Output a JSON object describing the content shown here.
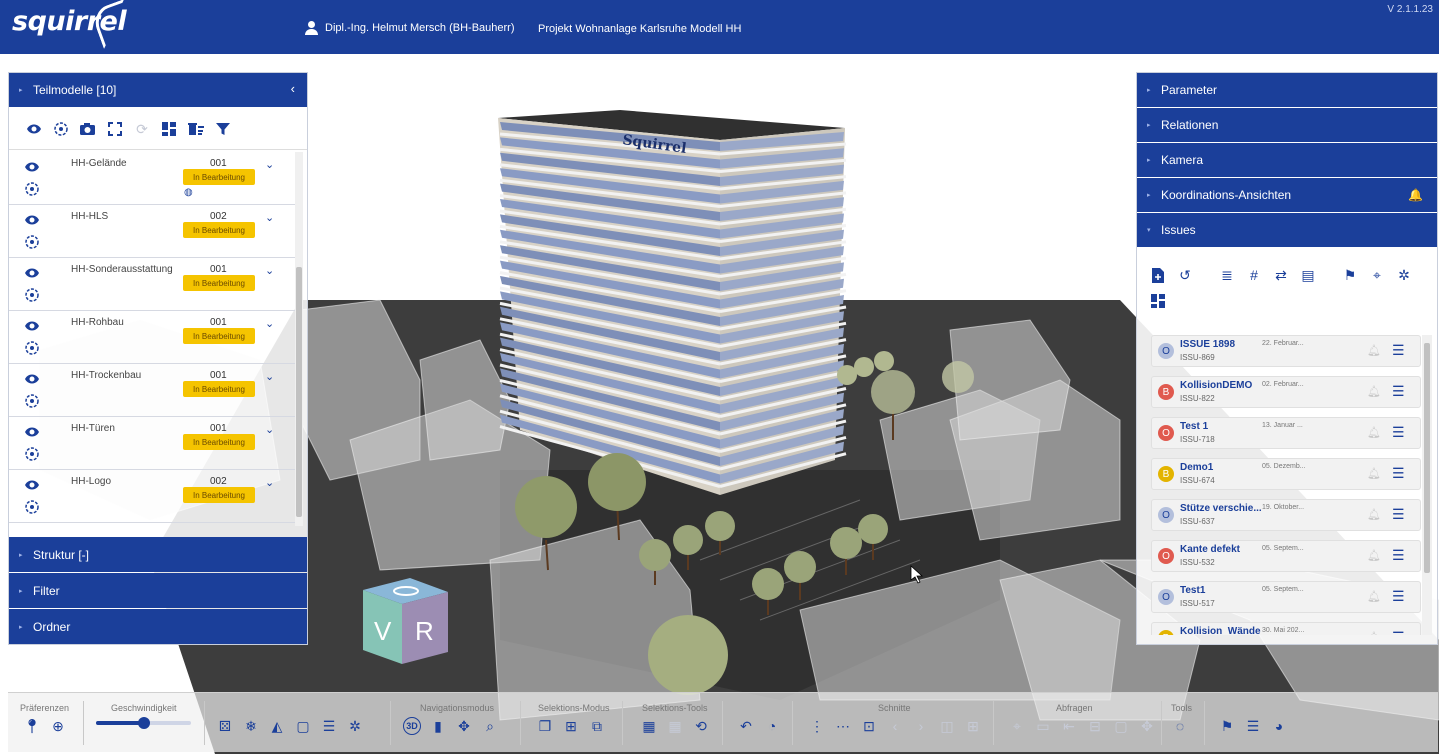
{
  "header": {
    "logo": "squirrel",
    "user": "Dipl.-Ing. Helmut Mersch (BH-Bauherr)",
    "project": "Projekt Wohnanlage Karlsruhe Modell HH",
    "version": "V 2.1.1.23"
  },
  "left_panel": {
    "title": "Teilmodelle [10]",
    "models": [
      {
        "name": "HH-Gelände",
        "num": "001",
        "status": "In Bearbeitung"
      },
      {
        "name": "HH-HLS",
        "num": "002",
        "status": "In Bearbeitung"
      },
      {
        "name": "HH-Sonderausstattung",
        "num": "001",
        "status": "In Bearbeitung"
      },
      {
        "name": "HH-Rohbau",
        "num": "001",
        "status": "In Bearbeitung"
      },
      {
        "name": "HH-Trockenbau",
        "num": "001",
        "status": "In Bearbeitung"
      },
      {
        "name": "HH-Türen",
        "num": "001",
        "status": "In Bearbeitung"
      },
      {
        "name": "HH-Logo",
        "num": "002",
        "status": "In Bearbeitung"
      }
    ],
    "sections": [
      "Struktur [-]",
      "Filter",
      "Ordner"
    ]
  },
  "right_panel": {
    "sections": [
      "Parameter",
      "Relationen",
      "Kamera",
      "Koordinations-Ansichten",
      "Issues"
    ],
    "issues": [
      {
        "letter": "O",
        "color": "#b3bfdc",
        "title": "ISSUE 1898",
        "id": "ISSU-869",
        "date": "22. Februar..."
      },
      {
        "letter": "B",
        "color": "#e05a4f",
        "title": "KollisionDEMO",
        "id": "ISSU-822",
        "date": "02. Februar..."
      },
      {
        "letter": "O",
        "color": "#e05a4f",
        "title": "Test 1",
        "id": "ISSU-718",
        "date": "13. Januar ..."
      },
      {
        "letter": "B",
        "color": "#e3b400",
        "title": "Demo1",
        "id": "ISSU-674",
        "date": "05. Dezemb..."
      },
      {
        "letter": "O",
        "color": "#b3bfdc",
        "title": "Stütze verschie...",
        "id": "ISSU-637",
        "date": "19. Oktober..."
      },
      {
        "letter": "O",
        "color": "#e05a4f",
        "title": "Kante defekt",
        "id": "ISSU-532",
        "date": "05. Septem..."
      },
      {
        "letter": "O",
        "color": "#b3bfdc",
        "title": "Test1",
        "id": "ISSU-517",
        "date": "05. Septem..."
      },
      {
        "letter": "B",
        "color": "#e3b400",
        "title": "Kollision_Wände",
        "id": "",
        "date": "30. Mai 202..."
      }
    ]
  },
  "viewport": {
    "building_logo": "Squirrel",
    "cube_left": "V",
    "cube_right": "R"
  },
  "toolbar": {
    "groups": [
      "Präferenzen",
      "Geschwindigkeit",
      "Navigationsmodus",
      "Selektions-Modus",
      "Selektions-Tools",
      "Schnitte",
      "Abfragen",
      "Tools"
    ],
    "speed": 0.5
  },
  "colors": {
    "brand": "#1b3f9a",
    "status": "#f5c400"
  }
}
